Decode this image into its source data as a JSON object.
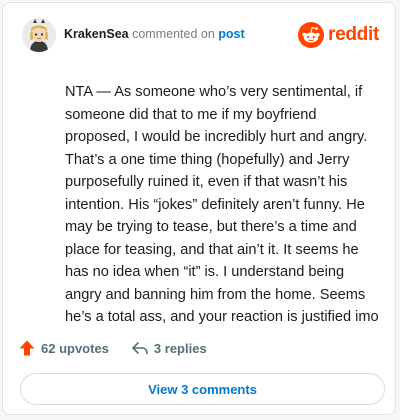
{
  "comment": {
    "username": "KrakenSea",
    "action_text": "commented on",
    "post_link": "post",
    "body": "NTA — As someone who’s very sentimental, if someone did that to me if my boyfriend proposed, I would be incredibly hurt and angry. That’s a one time thing (hopefully) and Jerry purposefully ruined it, even if that wasn’t his intention. His “jokes” definitely aren’t funny. He may be trying to tease, but there’s a time and place for teasing, and that ain’t it. It seems he has no idea when “it” is. I understand being angry and banning him from the home. Seems he’s a total ass, and your reaction is justified imo",
    "upvotes": "62 upvotes",
    "replies": "3 replies",
    "view_comments": "View 3 comments"
  },
  "brand": {
    "name": "reddit",
    "color": "#ff4500",
    "icon": "reddit-snoo-icon"
  },
  "icons": {
    "avatar": "avatar-character-icon",
    "upvote": "upvote-arrow-icon",
    "reply": "reply-arrow-icon"
  },
  "colors": {
    "link": "#0079d3",
    "upvote": "#ff4500",
    "muted": "#576f76",
    "text": "#1c1c1c"
  }
}
